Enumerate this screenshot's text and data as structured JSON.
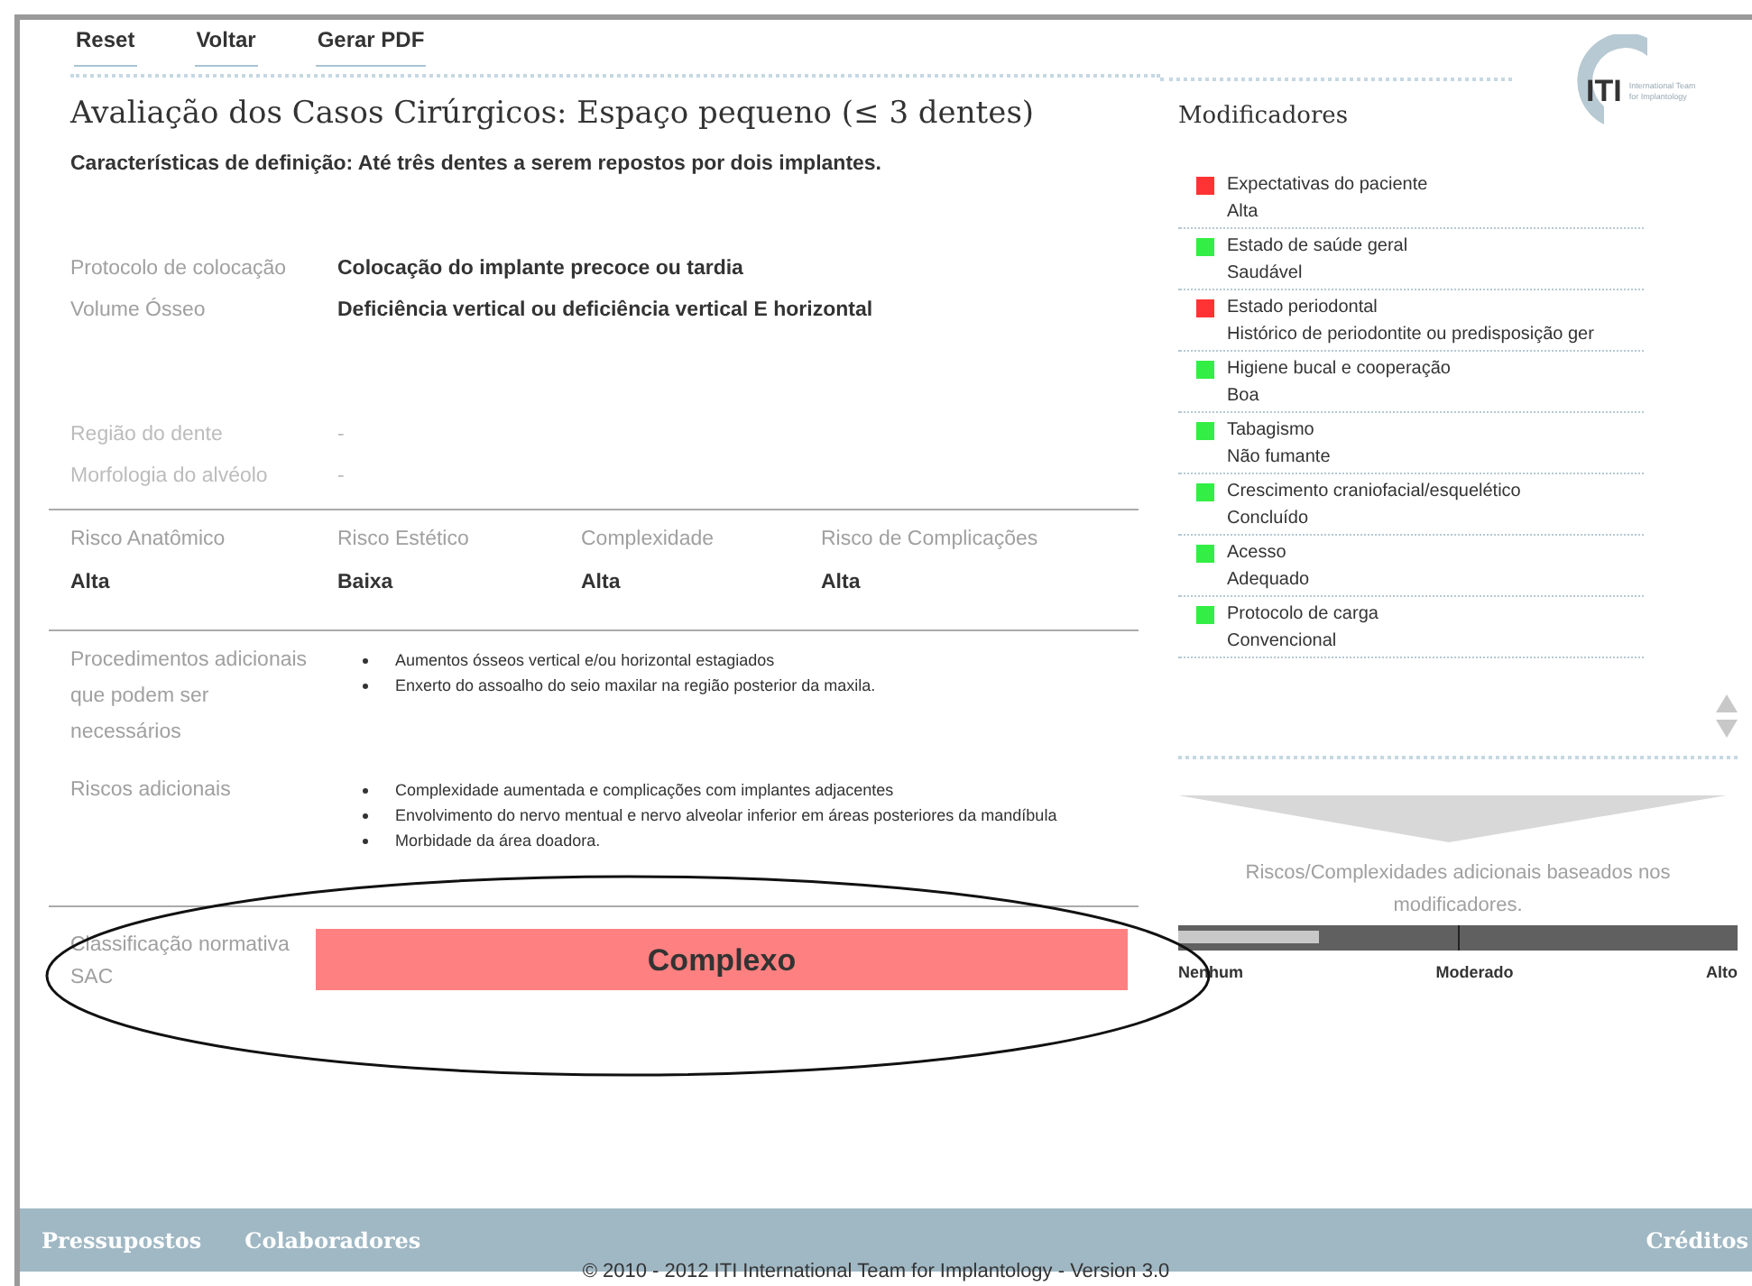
{
  "nav": [
    "Reset",
    "Voltar",
    "Gerar PDF"
  ],
  "logo": {
    "mark": "ITI",
    "caption": "International Team for Implantology"
  },
  "title": "Avaliação dos Casos Cirúrgicos: Espaço pequeno (≤ 3 dentes)",
  "definition": "Características de definição: Até três dentes a serem repostos por dois implantes.",
  "fields": [
    {
      "label": "Protocolo de colocação",
      "value": "Colocação do implante precoce ou tardia",
      "disabled": false
    },
    {
      "label": "Volume Ósseo",
      "value": "Deficiência vertical ou deficiência vertical E horizontal",
      "disabled": false
    },
    {
      "label": "Região do dente",
      "value": "-",
      "disabled": true
    },
    {
      "label": "Morfologia do alvéolo",
      "value": "-",
      "disabled": true
    }
  ],
  "risks": [
    {
      "label": "Risco Anatômico",
      "value": "Alta"
    },
    {
      "label": "Risco Estético",
      "value": "Baixa"
    },
    {
      "label": "Complexidade",
      "value": "Alta"
    },
    {
      "label": "Risco de Complicações",
      "value": "Alta"
    }
  ],
  "details": [
    {
      "label": "Procedimentos adicionais que podem ser necessários",
      "items": [
        "Aumentos ósseos vertical e/ou horizontal estagiados",
        "Enxerto do assoalho do seio maxilar na região posterior da maxila."
      ]
    },
    {
      "label": "Riscos adicionais",
      "items": [
        "Complexidade aumentada e complicações com implantes adjacentes",
        "Envolvimento do nervo mentual e nervo alveolar inferior em áreas posteriores da mandíbula",
        "Morbidade da área doadora."
      ]
    }
  ],
  "classification": {
    "label": "Classificação normativa SAC",
    "value": "Complexo",
    "color": "#ff8080"
  },
  "modifiers": {
    "title": "Modificadores",
    "items": [
      {
        "name": "Expectativas do paciente",
        "value": "Alta",
        "color": "#ff3333"
      },
      {
        "name": "Estado de saúde geral",
        "value": "Saudável",
        "color": "#33ee44"
      },
      {
        "name": "Estado periodontal",
        "value": "Histórico de periodontite ou predisposição ger",
        "color": "#ff3333"
      },
      {
        "name": "Higiene bucal e cooperação",
        "value": "Boa",
        "color": "#33ee44"
      },
      {
        "name": "Tabagismo",
        "value": "Não fumante",
        "color": "#33ee44"
      },
      {
        "name": "Crescimento craniofacial/esquelético",
        "value": "Concluído",
        "color": "#33ee44"
      },
      {
        "name": "Acesso",
        "value": "Adequado",
        "color": "#33ee44"
      },
      {
        "name": "Protocolo de carga",
        "value": "Convencional",
        "color": "#33ee44"
      }
    ]
  },
  "additional": {
    "caption": "Riscos/Complexidades adicionais baseados nos modificadores.",
    "level": 0.25,
    "scale": [
      "Nenhum",
      "Moderado",
      "Alto"
    ]
  },
  "footer": {
    "links": [
      "Pressupostos",
      "Colaboradores"
    ],
    "right_link": "Créditos",
    "copyright": "© 2010 - 2012 ITI International Team for Implantology - Version 3.0"
  }
}
